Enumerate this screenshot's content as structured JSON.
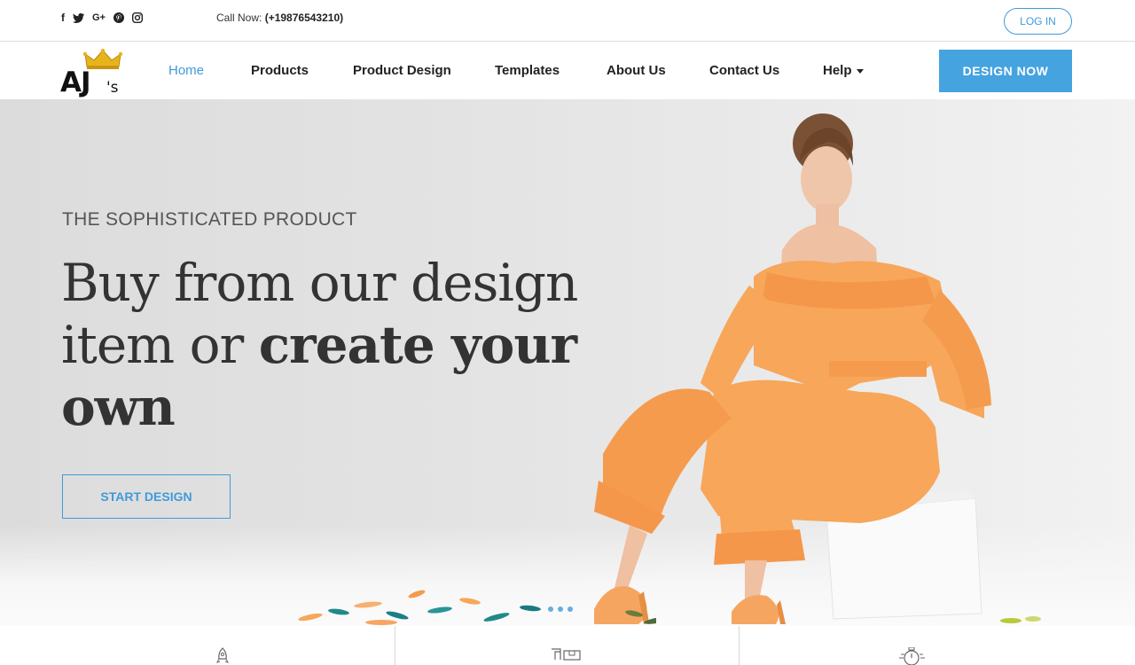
{
  "topbar": {
    "social_icons": [
      "facebook-icon",
      "twitter-icon",
      "google-plus-icon",
      "pinterest-icon",
      "instagram-icon"
    ],
    "call_label": "Call Now:",
    "call_number": "(+19876543210)",
    "login_label": "LOG IN"
  },
  "nav": {
    "logo_text": "AJ",
    "logo_suffix": "'s",
    "items": [
      {
        "label": "Home",
        "active": true
      },
      {
        "label": "Products"
      },
      {
        "label": "Product Design"
      },
      {
        "label": "Templates"
      },
      {
        "label": "About Us"
      },
      {
        "label": "Contact Us"
      },
      {
        "label": "Help"
      }
    ],
    "design_now_label": "DESIGN NOW"
  },
  "hero": {
    "eyebrow": "THE SOPHISTICATED PRODUCT",
    "headline_line1": "Buy from our design",
    "headline_line2_plain": "item or ",
    "headline_line2_bold": "create your",
    "headline_line3_bold": "own",
    "cta_label": "START DESIGN",
    "slide_count": 3
  },
  "features": {
    "icons": [
      "rocket-icon",
      "delivery-truck-icon",
      "stopwatch-icon"
    ]
  },
  "colors": {
    "accent": "#3f9bd9",
    "button_fill": "#45a3e0",
    "outfit": "#f7a65a",
    "crown": "#e8b41c"
  }
}
